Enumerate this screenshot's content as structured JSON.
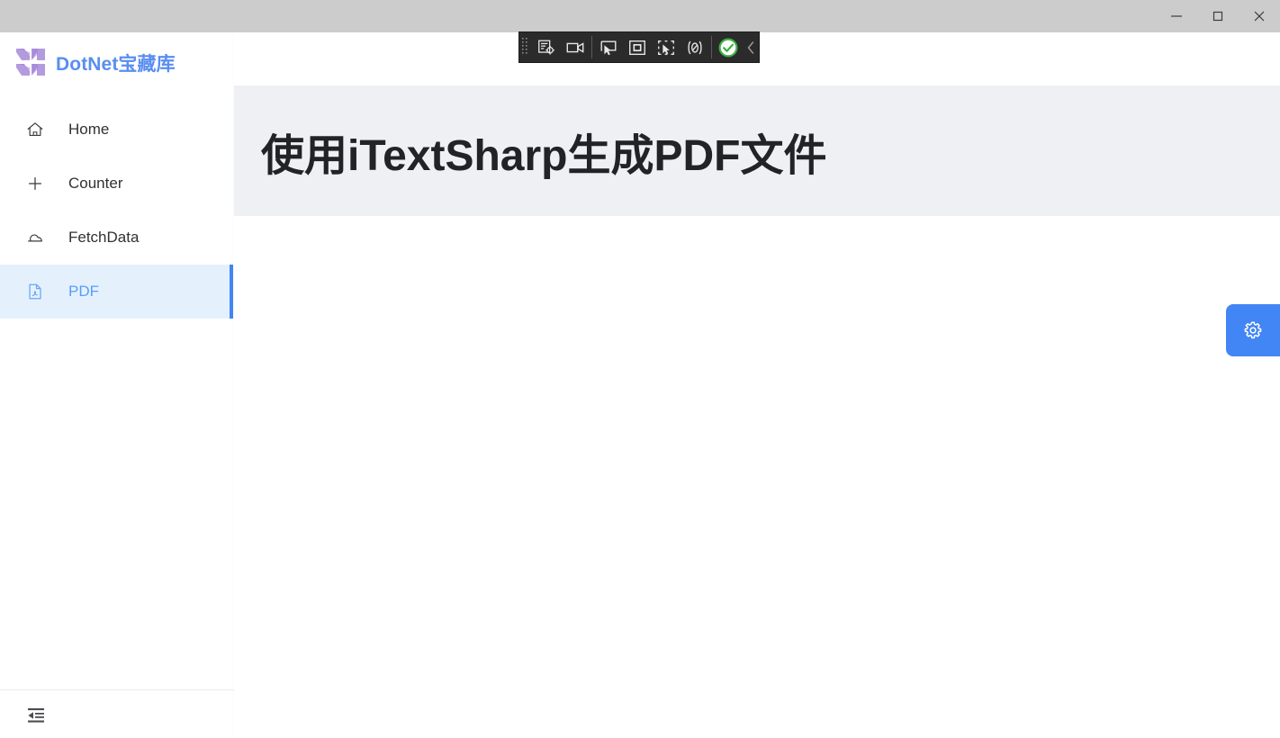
{
  "window": {
    "titlebar_color": "#cccccc",
    "controls": [
      {
        "name": "minimize",
        "glyph": "minimize-icon",
        "tooltip": "Minimize"
      },
      {
        "name": "maximize",
        "glyph": "maximize-icon",
        "tooltip": "Maximize"
      },
      {
        "name": "close",
        "glyph": "close-icon",
        "tooltip": "Close"
      }
    ]
  },
  "sidebar": {
    "brand": {
      "logo_icon": "dotnet-logo-icon",
      "title": "DotNet宝藏库",
      "title_color": "#5a8ef2",
      "logo_color": "#b49be0"
    },
    "items": [
      {
        "label": "Home",
        "icon": "home-icon",
        "active": false
      },
      {
        "label": "Counter",
        "icon": "plus-icon",
        "active": false
      },
      {
        "label": "FetchData",
        "icon": "cloud-icon",
        "active": false
      },
      {
        "label": "PDF",
        "icon": "pdf-file-icon",
        "active": true
      }
    ],
    "active_background": "#e4f1fd",
    "active_accent": "#4285f4",
    "footer": {
      "collapse_icon": "collapse-sidebar-icon",
      "collapse_label": "Collapse navigation"
    }
  },
  "main": {
    "banner_background": "#eff0f4",
    "page_title": "使用iTextSharp生成PDF文件",
    "content": ""
  },
  "settings_fab": {
    "icon": "gear-icon",
    "label": "Settings",
    "color": "#4285f4"
  },
  "recorder_toolbar": {
    "background": "#2b2b2b",
    "grip_icon": "drag-grip-icon",
    "buttons": [
      {
        "name": "record-steps",
        "icon": "record-steps-icon",
        "tooltip": "Record steps"
      },
      {
        "name": "record-video",
        "icon": "video-camera-icon",
        "tooltip": "Record video"
      },
      {
        "name": "select-element",
        "icon": "pointer-select-icon",
        "tooltip": "Select element"
      },
      {
        "name": "highlight-element",
        "icon": "square-outline-icon",
        "tooltip": "Highlight element"
      },
      {
        "name": "capture-region",
        "icon": "crop-pointer-icon",
        "tooltip": "Capture region"
      },
      {
        "name": "inspect-code",
        "icon": "code-brackets-icon",
        "tooltip": "Inspect code"
      },
      {
        "name": "verify-ok",
        "icon": "green-check-circle-icon",
        "tooltip": "Verify"
      }
    ],
    "collapse_icon": "chevron-left-icon",
    "accent_ok": "#3faf46"
  }
}
